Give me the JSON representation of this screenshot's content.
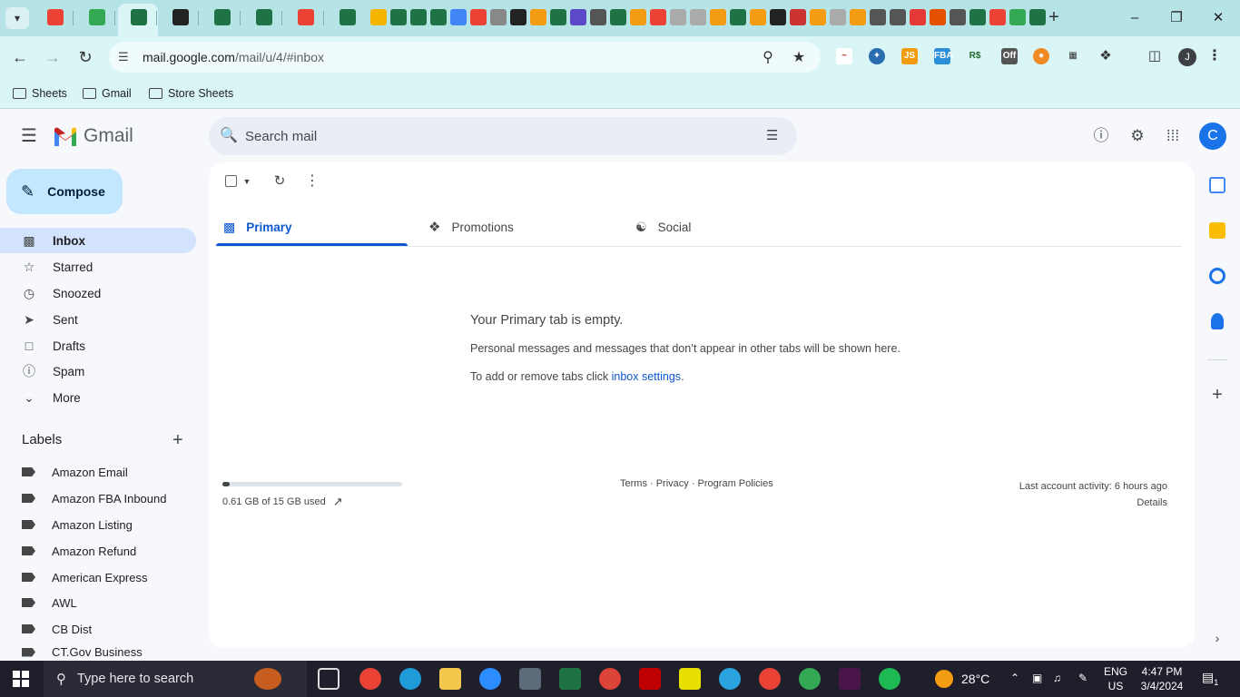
{
  "browser": {
    "url_host": "mail.google.com",
    "url_path": "/mail/u/4/#inbox",
    "bookmarks": [
      "Sheets",
      "Gmail",
      "Store Sheets"
    ],
    "profile_initial": "J"
  },
  "gmail": {
    "brand": "Gmail",
    "search_placeholder": "Search mail",
    "avatar_initial": "C",
    "compose_label": "Compose",
    "nav": [
      {
        "label": "Inbox",
        "icon": "inbox-icon"
      },
      {
        "label": "Starred",
        "icon": "star-icon"
      },
      {
        "label": "Snoozed",
        "icon": "clock-icon"
      },
      {
        "label": "Sent",
        "icon": "send-icon"
      },
      {
        "label": "Drafts",
        "icon": "draft-icon"
      },
      {
        "label": "Spam",
        "icon": "spam-icon"
      },
      {
        "label": "More",
        "icon": "chevron-down-icon"
      }
    ],
    "labels_heading": "Labels",
    "labels": [
      "Amazon Email",
      "Amazon FBA Inbound",
      "Amazon Listing",
      "Amazon Refund",
      "American Express",
      "AWL",
      "CB Dist",
      "CT.Gov Business"
    ],
    "tabs": [
      {
        "label": "Primary",
        "icon": "inbox-icon"
      },
      {
        "label": "Promotions",
        "icon": "tag-icon"
      },
      {
        "label": "Social",
        "icon": "people-icon"
      }
    ],
    "empty": {
      "heading": "Your Primary tab is empty.",
      "body": "Personal messages and messages that don’t appear in other tabs will be shown here.",
      "settings_prefix": "To add or remove tabs click ",
      "settings_link": "inbox settings",
      "settings_suffix": "."
    },
    "storage": {
      "used_text": "0.61 GB of 15 GB used",
      "fraction": 0.04
    },
    "footer": {
      "links": "Terms · Privacy · Program Policies",
      "activity": "Last account activity: 6 hours ago",
      "details": "Details"
    }
  },
  "taskbar": {
    "search_placeholder": "Type here to search",
    "temperature": "28°C",
    "lang_top": "ENG",
    "lang_bottom": "US",
    "time": "4:47 PM",
    "date": "3/4/2024",
    "notification_count": "1"
  },
  "colors": {
    "accent": "#0b57d0",
    "compose_bg": "#c2e7ff",
    "active_nav": "#d3e3fd",
    "browser_frame": "#b6e3e6"
  }
}
